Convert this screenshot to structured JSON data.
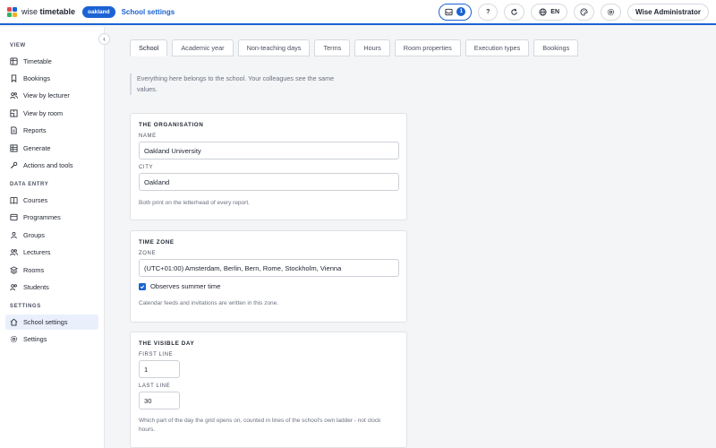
{
  "app": {
    "brand_plain": "wise ",
    "brand_bold": "timetable",
    "school_pill": "oakland",
    "page_heading": "School settings"
  },
  "header": {
    "notification_count": "1",
    "help_label": "?",
    "language": "EN",
    "user_name": "Wise Administrator"
  },
  "sidebar": {
    "sections": {
      "view": "VIEW",
      "data_entry": "DATA ENTRY",
      "settings": "SETTINGS"
    },
    "items": [
      {
        "label": "Timetable",
        "icon": "table-icon"
      },
      {
        "label": "Bookings",
        "icon": "bookmark-icon"
      },
      {
        "label": "View by lecturer",
        "icon": "people-icon"
      },
      {
        "label": "View by room",
        "icon": "room-icon"
      },
      {
        "label": "Reports",
        "icon": "document-icon"
      },
      {
        "label": "Generate",
        "icon": "grid-icon"
      },
      {
        "label": "Actions and tools",
        "icon": "wrench-icon"
      },
      {
        "label": "Courses",
        "icon": "book-icon"
      },
      {
        "label": "Programmes",
        "icon": "layers-icon"
      },
      {
        "label": "Groups",
        "icon": "group-icon"
      },
      {
        "label": "Lecturers",
        "icon": "people-icon"
      },
      {
        "label": "Rooms",
        "icon": "stack-icon"
      },
      {
        "label": "Students",
        "icon": "group-icon"
      },
      {
        "label": "School settings",
        "icon": "home-icon"
      },
      {
        "label": "Settings",
        "icon": "gear-icon"
      }
    ]
  },
  "tabs": [
    "School",
    "Academic year",
    "Non-teaching days",
    "Terms",
    "Hours",
    "Room properties",
    "Execution types",
    "Bookings"
  ],
  "intro": "Everything here belongs to the school. Your colleagues see the same values.",
  "organisation": {
    "title": "THE ORGANISATION",
    "name_label": "NAME",
    "name_value": "Oakland University",
    "city_label": "CITY",
    "city_value": "Oakland",
    "hint": "Both print on the letterhead of every report."
  },
  "timezone": {
    "title": "TIME ZONE",
    "zone_label": "ZONE",
    "zone_value": "(UTC+01:00) Amsterdam, Berlin, Bern, Rome, Stockholm, Vienna",
    "dst_label": "Observes summer time",
    "dst_checked": true,
    "hint": "Calendar feeds and invitations are written in this zone."
  },
  "visible_day": {
    "title": "THE VISIBLE DAY",
    "first_label": "FIRST LINE",
    "first_value": "1",
    "last_label": "LAST LINE",
    "last_value": "30",
    "hint": "Which part of the day the grid opens on, counted in lines of the school's own ladder - not clock hours."
  },
  "colors": {
    "accent": "#1b63d4",
    "logo": [
      "#e5484d",
      "#1b63d4",
      "#2fb36a",
      "#f2b01e"
    ]
  }
}
